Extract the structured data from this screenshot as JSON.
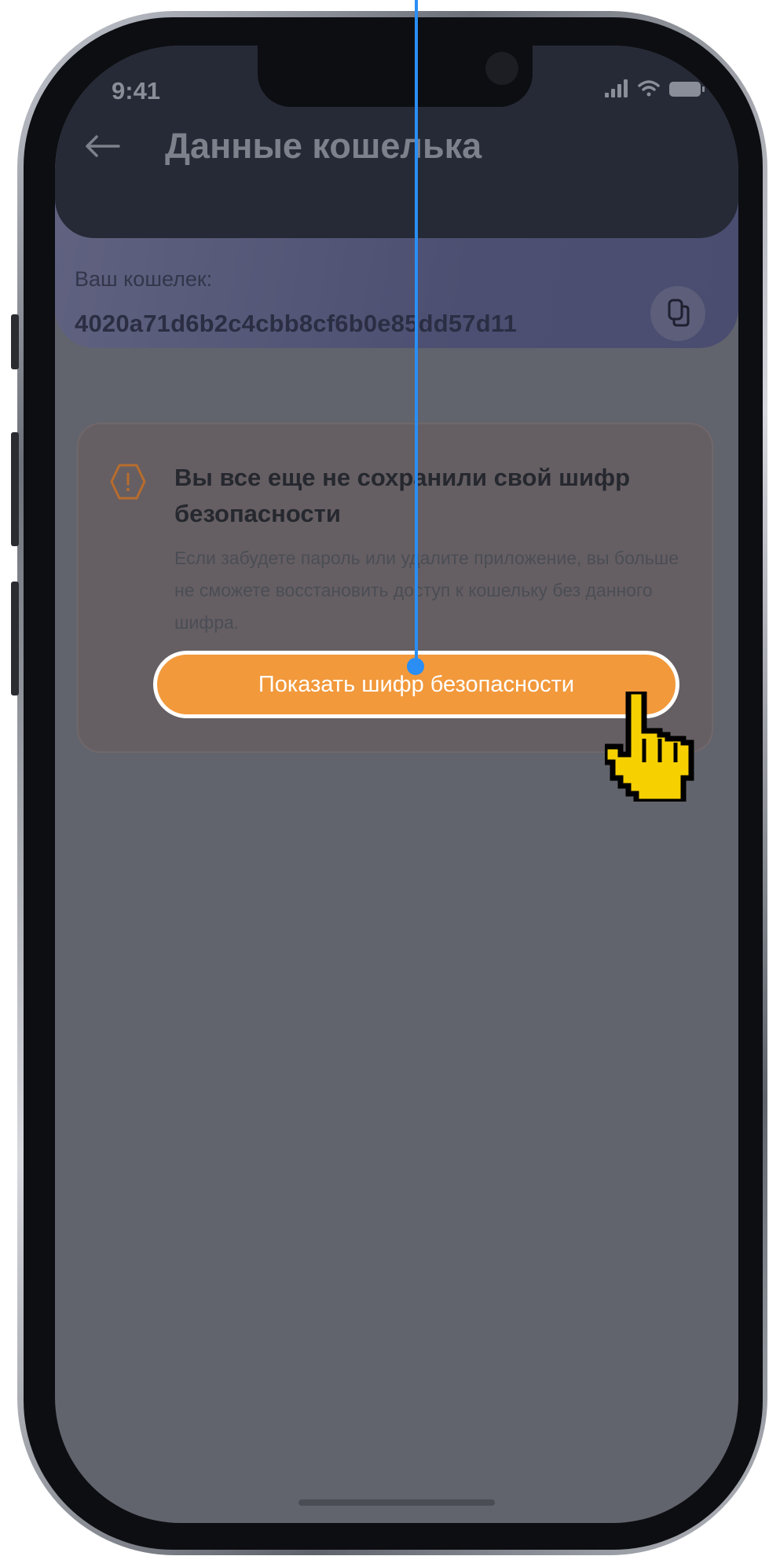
{
  "status_bar": {
    "time": "9:41"
  },
  "header": {
    "title": "Данные кошелька"
  },
  "wallet": {
    "label": "Ваш кошелек:",
    "address": "4020a71d6b2c4cbb8cf6b0e85dd57d11"
  },
  "warning": {
    "title": "Вы все еще не сохранили свой шифр безопасности",
    "text": "Если забудете пароль или удалите приложение, вы больше не сможете восстановить доступ к кошельку без данного шифра.",
    "button_label": "Показать шифр безопасности",
    "accent_color": "#f2993c"
  },
  "icons": [
    "back-arrow-icon",
    "copy-icon",
    "warning-icon",
    "signal-icon",
    "wifi-icon",
    "battery-icon",
    "hand-cursor-icon"
  ]
}
